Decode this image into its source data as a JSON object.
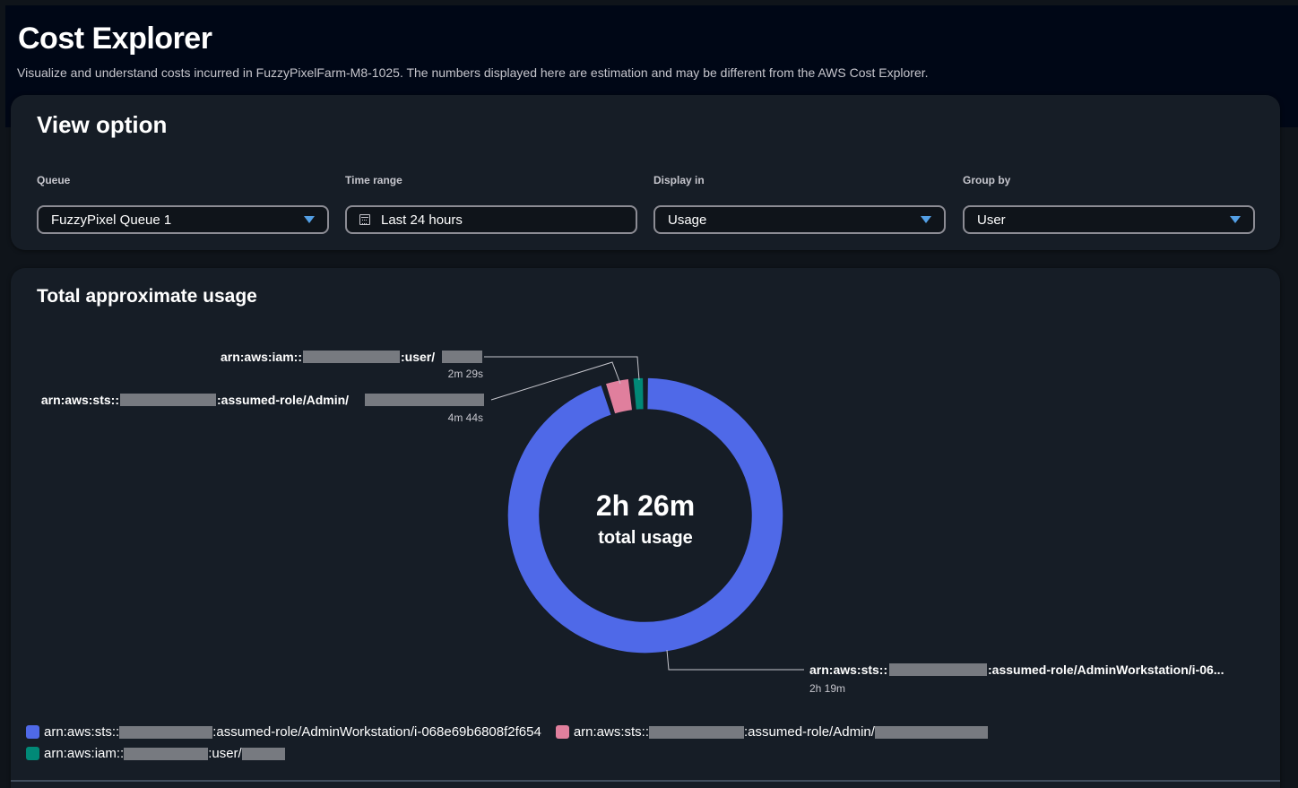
{
  "header": {
    "title": "Cost Explorer",
    "subtitle": "Visualize and understand costs incurred in FuzzyPixelFarm-M8-1025. The numbers displayed here are estimation and may be different from the AWS Cost Explorer."
  },
  "view_option": {
    "title": "View option",
    "queue": {
      "label": "Queue",
      "value": "FuzzyPixel Queue 1"
    },
    "time_range": {
      "label": "Time range",
      "value": "Last 24 hours"
    },
    "display_in": {
      "label": "Display in",
      "value": "Usage"
    },
    "group_by": {
      "label": "Group by",
      "value": "User"
    }
  },
  "usage": {
    "title": "Total approximate usage",
    "total_value": "2h 26m",
    "total_label": "total usage",
    "callouts": {
      "admin_workstation": {
        "prefix": "arn:aws:sts::",
        "suffix": ":assumed-role/AdminWorkstation/i-06...",
        "duration": "2h 19m"
      },
      "admin": {
        "prefix": "arn:aws:sts::",
        "suffix": ":assumed-role/Admin/",
        "duration": "4m 44s"
      },
      "iam_user": {
        "prefix": "arn:aws:iam::",
        "suffix": ":user/",
        "duration": "2m 29s"
      }
    },
    "legend": {
      "admin_workstation": {
        "prefix": "arn:aws:sts::",
        "suffix": ":assumed-role/AdminWorkstation/i-068e69b6808f2f654"
      },
      "admin": {
        "prefix": "arn:aws:sts::",
        "suffix": ":assumed-role/Admin/"
      },
      "iam_user": {
        "prefix": "arn:aws:iam::",
        "suffix": ":user/"
      }
    }
  },
  "chart_data": {
    "type": "pie",
    "style": "donut",
    "categories": [
      "arn:aws:sts:: :assumed-role/AdminWorkstation/i-068e69b6808f2f654",
      "arn:aws:sts:: :assumed-role/Admin/",
      "arn:aws:iam:: :user/"
    ],
    "values_minutes": [
      139,
      4.73,
      2.48
    ],
    "value_labels": [
      "2h 19m",
      "4m 44s",
      "2m 29s"
    ],
    "colors": [
      "#4f69e8",
      "#e07f9d",
      "#018977"
    ],
    "center_value": "2h 26m",
    "center_label": "total usage",
    "legend_position": "bottom-left"
  }
}
